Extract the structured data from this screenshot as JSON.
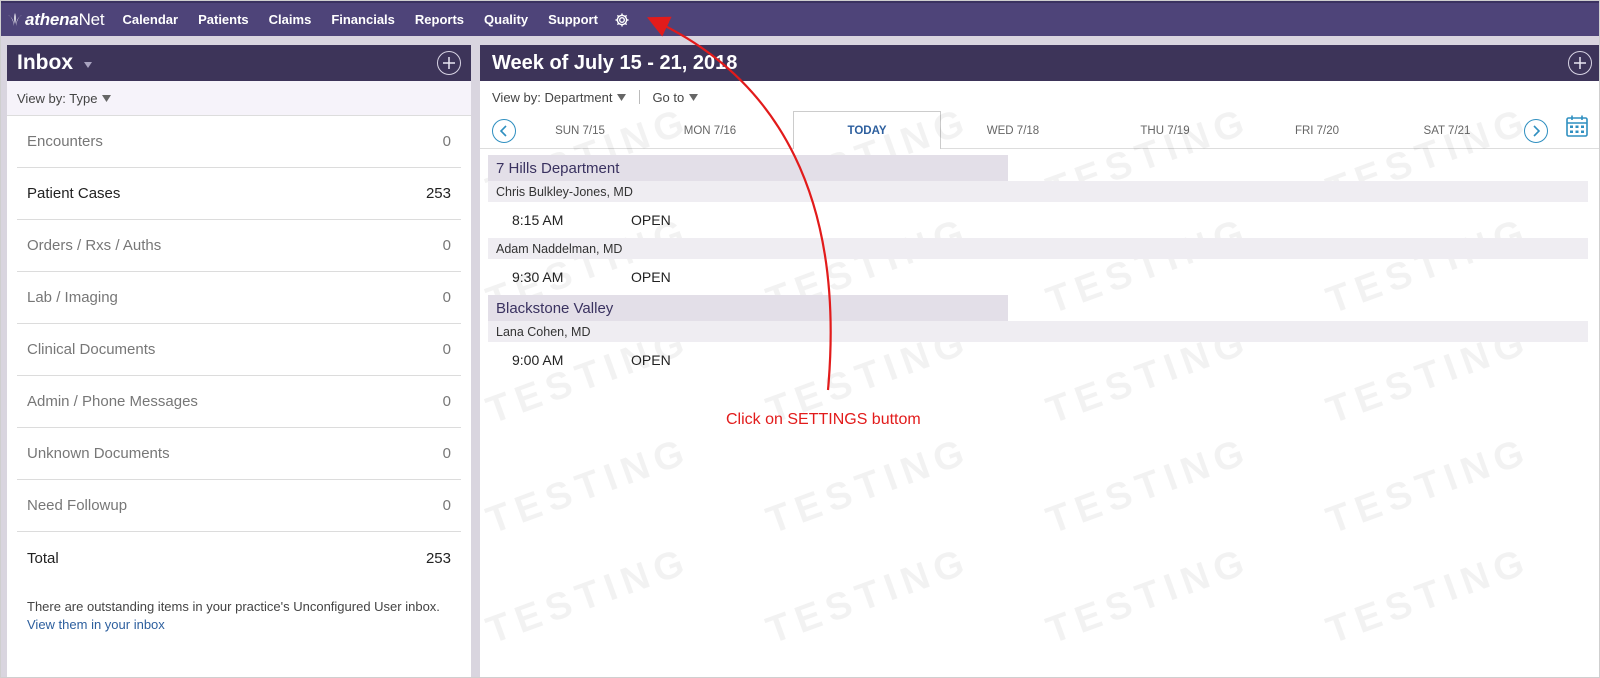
{
  "brand": {
    "logo_prefix": "athena",
    "logo_suffix": "Net"
  },
  "nav": {
    "items": [
      "Calendar",
      "Patients",
      "Claims",
      "Financials",
      "Reports",
      "Quality",
      "Support"
    ],
    "settings_icon": "gear-icon"
  },
  "inbox": {
    "title": "Inbox",
    "view_by": "View by: Type",
    "rows": [
      {
        "label": "Encounters",
        "count": "0"
      },
      {
        "label": "Patient Cases",
        "count": "253"
      },
      {
        "label": "Orders / Rxs / Auths",
        "count": "0"
      },
      {
        "label": "Lab / Imaging",
        "count": "0"
      },
      {
        "label": "Clinical Documents",
        "count": "0"
      },
      {
        "label": "Admin / Phone Messages",
        "count": "0"
      },
      {
        "label": "Unknown Documents",
        "count": "0"
      },
      {
        "label": "Need Followup",
        "count": "0"
      }
    ],
    "total_label": "Total",
    "total_count": "253",
    "note_text": "There are outstanding items in your practice's Unconfigured User inbox.",
    "note_link": "View them in your inbox"
  },
  "schedule": {
    "title": "Week of July 15 - 21, 2018",
    "view_by": "View by: Department",
    "go_to": "Go to",
    "days": [
      "SUN 7/15",
      "MON 7/16",
      "TODAY",
      "WED 7/18",
      "THU 7/19",
      "FRI 7/20",
      "SAT 7/21"
    ],
    "departments": [
      {
        "name": "7 Hills Department",
        "providers": [
          {
            "name": "Chris Bulkley-Jones, MD",
            "appointments": [
              {
                "time": "8:15 AM",
                "status": "OPEN"
              }
            ]
          },
          {
            "name": "Adam Naddelman, MD",
            "appointments": [
              {
                "time": "9:30 AM",
                "status": "OPEN"
              }
            ]
          }
        ]
      },
      {
        "name": "Blackstone Valley",
        "providers": [
          {
            "name": "Lana Cohen, MD",
            "appointments": [
              {
                "time": "9:00 AM",
                "status": "OPEN"
              }
            ]
          }
        ]
      }
    ],
    "watermark": "TESTING"
  },
  "annotation": {
    "text": "Click on SETTINGS buttom",
    "color": "#e21b1b"
  },
  "colors": {
    "nav_bg": "#4e4479",
    "panel_head_bg": "#3d3459",
    "link": "#2d5f9e",
    "accent_blue": "#2f8fc0"
  }
}
